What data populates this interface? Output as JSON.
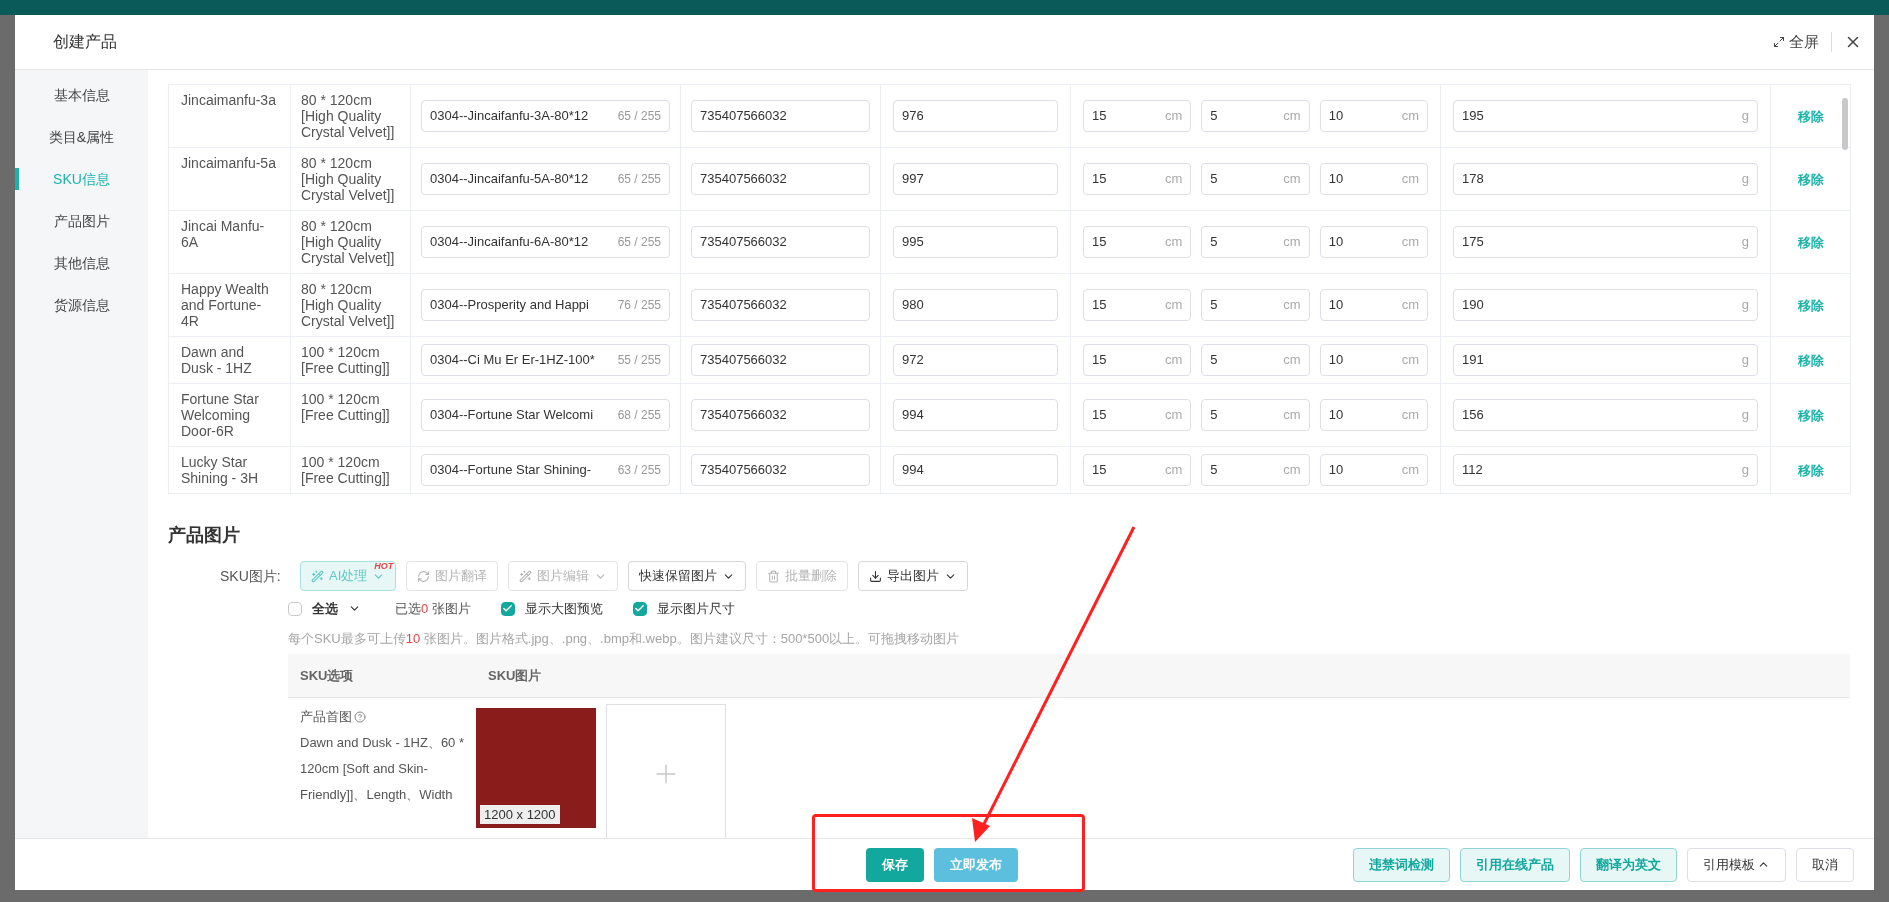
{
  "window": {
    "title": "创建产品",
    "fullscreen": "全屏"
  },
  "sidebar": {
    "items": [
      {
        "label": "基本信息",
        "selected": false
      },
      {
        "label": "类目&属性",
        "selected": false
      },
      {
        "label": "SKU信息",
        "selected": true
      },
      {
        "label": "产品图片",
        "selected": false
      },
      {
        "label": "其他信息",
        "selected": false
      },
      {
        "label": "货源信息",
        "selected": false
      }
    ]
  },
  "sku_table": {
    "rows": [
      {
        "name": "Jincaimanfu-3a",
        "spec": "80 * 120cm [High Quality Crystal Velvet]]",
        "title": "0304--Jincaifanfu-3A-80*12",
        "title_count": "65 / 255",
        "barcode": "735407566032",
        "stock": "976",
        "dims": [
          {
            "value": "15",
            "unit": "cm"
          },
          {
            "value": "5",
            "unit": "cm"
          },
          {
            "value": "10",
            "unit": "cm"
          }
        ],
        "weight": {
          "value": "195",
          "unit": "g"
        },
        "action": "移除"
      },
      {
        "name": "Jincaimanfu-5a",
        "spec": "80 * 120cm [High Quality Crystal Velvet]]",
        "title": "0304--Jincaifanfu-5A-80*12",
        "title_count": "65 / 255",
        "barcode": "735407566032",
        "stock": "997",
        "dims": [
          {
            "value": "15",
            "unit": "cm"
          },
          {
            "value": "5",
            "unit": "cm"
          },
          {
            "value": "10",
            "unit": "cm"
          }
        ],
        "weight": {
          "value": "178",
          "unit": "g"
        },
        "action": "移除"
      },
      {
        "name": "Jincai Manfu-6A",
        "spec": "80 * 120cm [High Quality Crystal Velvet]]",
        "title": "0304--Jincaifanfu-6A-80*12",
        "title_count": "65 / 255",
        "barcode": "735407566032",
        "stock": "995",
        "dims": [
          {
            "value": "15",
            "unit": "cm"
          },
          {
            "value": "5",
            "unit": "cm"
          },
          {
            "value": "10",
            "unit": "cm"
          }
        ],
        "weight": {
          "value": "175",
          "unit": "g"
        },
        "action": "移除"
      },
      {
        "name": "Happy Wealth and Fortune-4R",
        "spec": "80 * 120cm [High Quality Crystal Velvet]]",
        "title": "0304--Prosperity and Happi",
        "title_count": "76 / 255",
        "barcode": "735407566032",
        "stock": "980",
        "dims": [
          {
            "value": "15",
            "unit": "cm"
          },
          {
            "value": "5",
            "unit": "cm"
          },
          {
            "value": "10",
            "unit": "cm"
          }
        ],
        "weight": {
          "value": "190",
          "unit": "g"
        },
        "action": "移除"
      },
      {
        "name": "Dawn and Dusk - 1HZ",
        "spec": "100 * 120cm [Free Cutting]]",
        "title": "0304--Ci Mu Er Er-1HZ-100*",
        "title_count": "55 / 255",
        "barcode": "735407566032",
        "stock": "972",
        "dims": [
          {
            "value": "15",
            "unit": "cm"
          },
          {
            "value": "5",
            "unit": "cm"
          },
          {
            "value": "10",
            "unit": "cm"
          }
        ],
        "weight": {
          "value": "191",
          "unit": "g"
        },
        "action": "移除"
      },
      {
        "name": "Fortune Star Welcoming Door-6R",
        "spec": "100 * 120cm [Free Cutting]]",
        "title": "0304--Fortune Star Welcomi",
        "title_count": "68 / 255",
        "barcode": "735407566032",
        "stock": "994",
        "dims": [
          {
            "value": "15",
            "unit": "cm"
          },
          {
            "value": "5",
            "unit": "cm"
          },
          {
            "value": "10",
            "unit": "cm"
          }
        ],
        "weight": {
          "value": "156",
          "unit": "g"
        },
        "action": "移除"
      },
      {
        "name": "Lucky Star Shining - 3H",
        "spec": "100 * 120cm [Free Cutting]]",
        "title": "0304--Fortune Star Shining-",
        "title_count": "63 / 255",
        "barcode": "735407566032",
        "stock": "994",
        "dims": [
          {
            "value": "15",
            "unit": "cm"
          },
          {
            "value": "5",
            "unit": "cm"
          },
          {
            "value": "10",
            "unit": "cm"
          }
        ],
        "weight": {
          "value": "112",
          "unit": "g"
        },
        "action": "移除"
      }
    ]
  },
  "images": {
    "title": "产品图片",
    "label": "SKU图片:",
    "toolbar": [
      {
        "label": "AI处理",
        "kind": "ai",
        "badge": "HOT",
        "dropdown": true,
        "disabled": false
      },
      {
        "label": "图片翻译",
        "kind": "translate",
        "dropdown": false,
        "disabled": true
      },
      {
        "label": "图片编辑",
        "kind": "edit",
        "dropdown": true,
        "disabled": true
      },
      {
        "label": "快速保留图片",
        "kind": "plain",
        "dropdown": true,
        "disabled": false
      },
      {
        "label": "批量删除",
        "kind": "delete",
        "dropdown": false,
        "disabled": true
      },
      {
        "label": "导出图片",
        "kind": "export",
        "dropdown": true,
        "disabled": false
      }
    ],
    "select_all": {
      "label": "全选",
      "checked": false
    },
    "selected_count": {
      "prefix": "已选",
      "count": "0",
      "suffix": "张图片"
    },
    "options": [
      {
        "label": "显示大图预览",
        "checked": true
      },
      {
        "label": "显示图片尺寸",
        "checked": true
      }
    ],
    "hint": {
      "prefix": "每个SKU最多可上传",
      "count": "10",
      "suffix": "张图片。图片格式.jpg、.png、.bmp和.webp。图片建议尺寸：500*500以上。可拖拽移动图片"
    },
    "columns": [
      "SKU选项",
      "SKU图片"
    ],
    "row": {
      "label": "产品首图",
      "description": "Dawn and Dusk - 1HZ、60 * 120cm [Soft and Skin-Friendly]]、Length、Width",
      "image_size": "1200 x 1200"
    }
  },
  "footer": {
    "left_buttons": [
      {
        "label": "保存",
        "kind": "primary"
      },
      {
        "label": "立即发布",
        "kind": "publish"
      }
    ],
    "right_buttons": [
      {
        "label": "违禁词检测",
        "kind": "light"
      },
      {
        "label": "引用在线产品",
        "kind": "light"
      },
      {
        "label": "翻译为英文",
        "kind": "light"
      },
      {
        "label": "引用模板",
        "kind": "dropdown"
      },
      {
        "label": "取消",
        "kind": "default"
      }
    ]
  }
}
